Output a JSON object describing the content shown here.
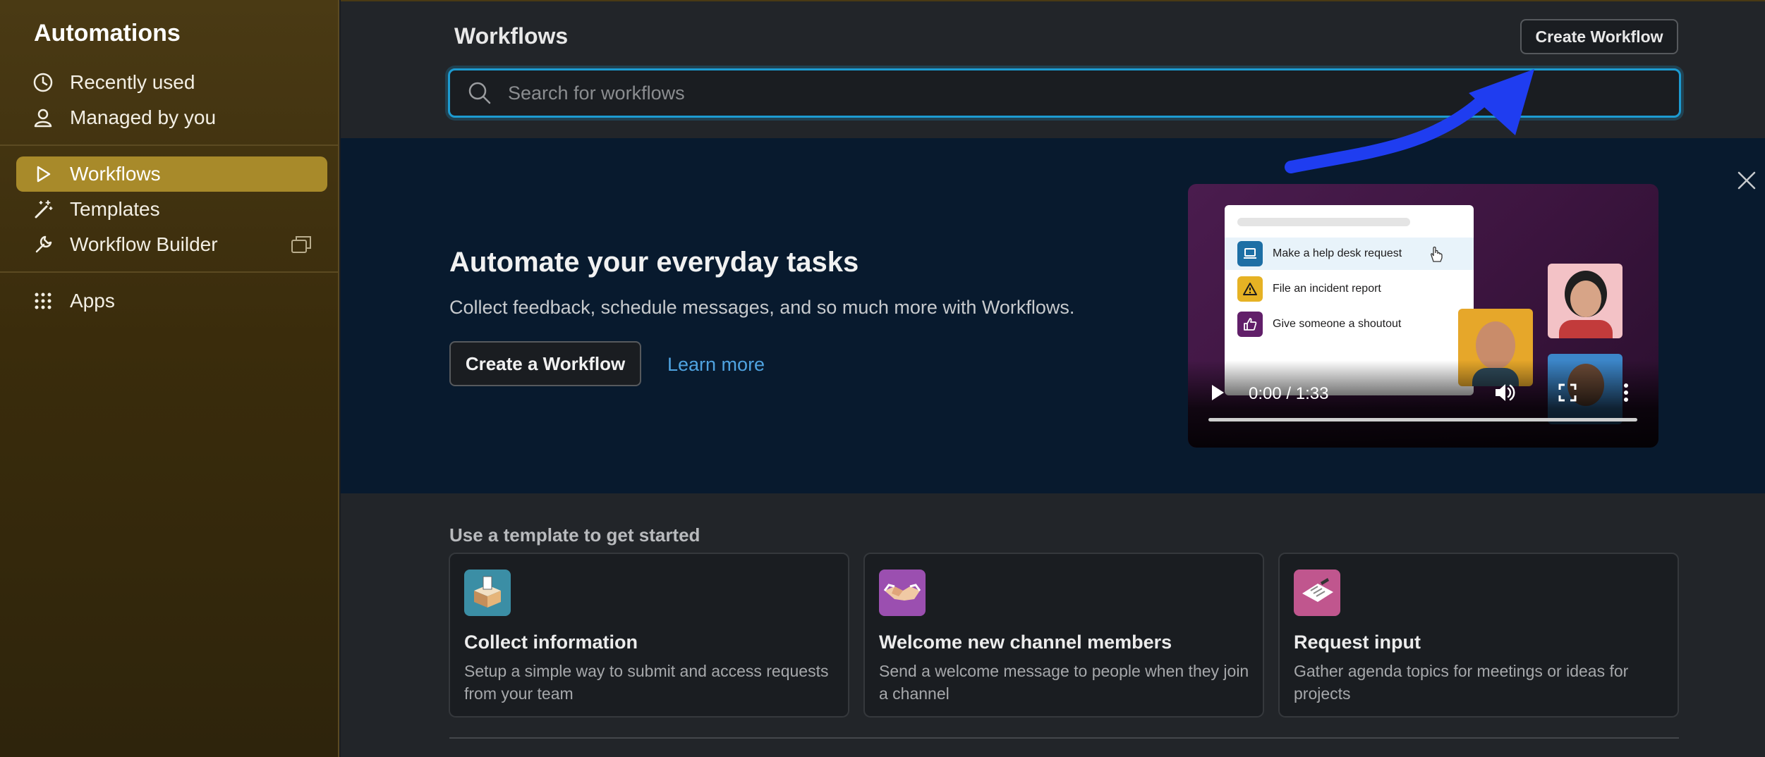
{
  "sidebar": {
    "title": "Automations",
    "items": [
      {
        "label": "Recently used",
        "icon": "clock-icon"
      },
      {
        "label": "Managed by you",
        "icon": "person-icon"
      },
      {
        "label": "Workflows",
        "icon": "play-icon",
        "active": true
      },
      {
        "label": "Templates",
        "icon": "magic-wand-icon"
      },
      {
        "label": "Workflow Builder",
        "icon": "wrench-icon"
      },
      {
        "label": "Apps",
        "icon": "apps-grid-icon"
      }
    ]
  },
  "header": {
    "title": "Workflows",
    "create_button": "Create Workflow"
  },
  "search": {
    "placeholder": "Search for workflows"
  },
  "hero": {
    "title": "Automate your everyday tasks",
    "subtitle": "Collect feedback, schedule messages, and so much more with Workflows.",
    "primary_button": "Create a Workflow",
    "link": "Learn more",
    "video": {
      "menu_items": [
        "Make a help desk request",
        "File an incident report",
        "Give someone a shoutout"
      ],
      "time": "0:00 / 1:33"
    }
  },
  "templates": {
    "heading": "Use a template to get started",
    "cards": [
      {
        "title": "Collect information",
        "description": "Setup a simple way to submit and access requests from your team",
        "tile_color": "#3b8ea5"
      },
      {
        "title": "Welcome new channel members",
        "description": "Send a welcome message to people when they join a channel",
        "tile_color": "#9b4fb0"
      },
      {
        "title": "Request input",
        "description": "Gather agenda topics for meetings or ideas for projects",
        "tile_color": "#c0568e"
      }
    ]
  },
  "colors": {
    "accent": "#a88a2a",
    "focus": "#1d9bd1",
    "link": "#4fa3e0",
    "annotation_arrow": "#1f3df0"
  }
}
